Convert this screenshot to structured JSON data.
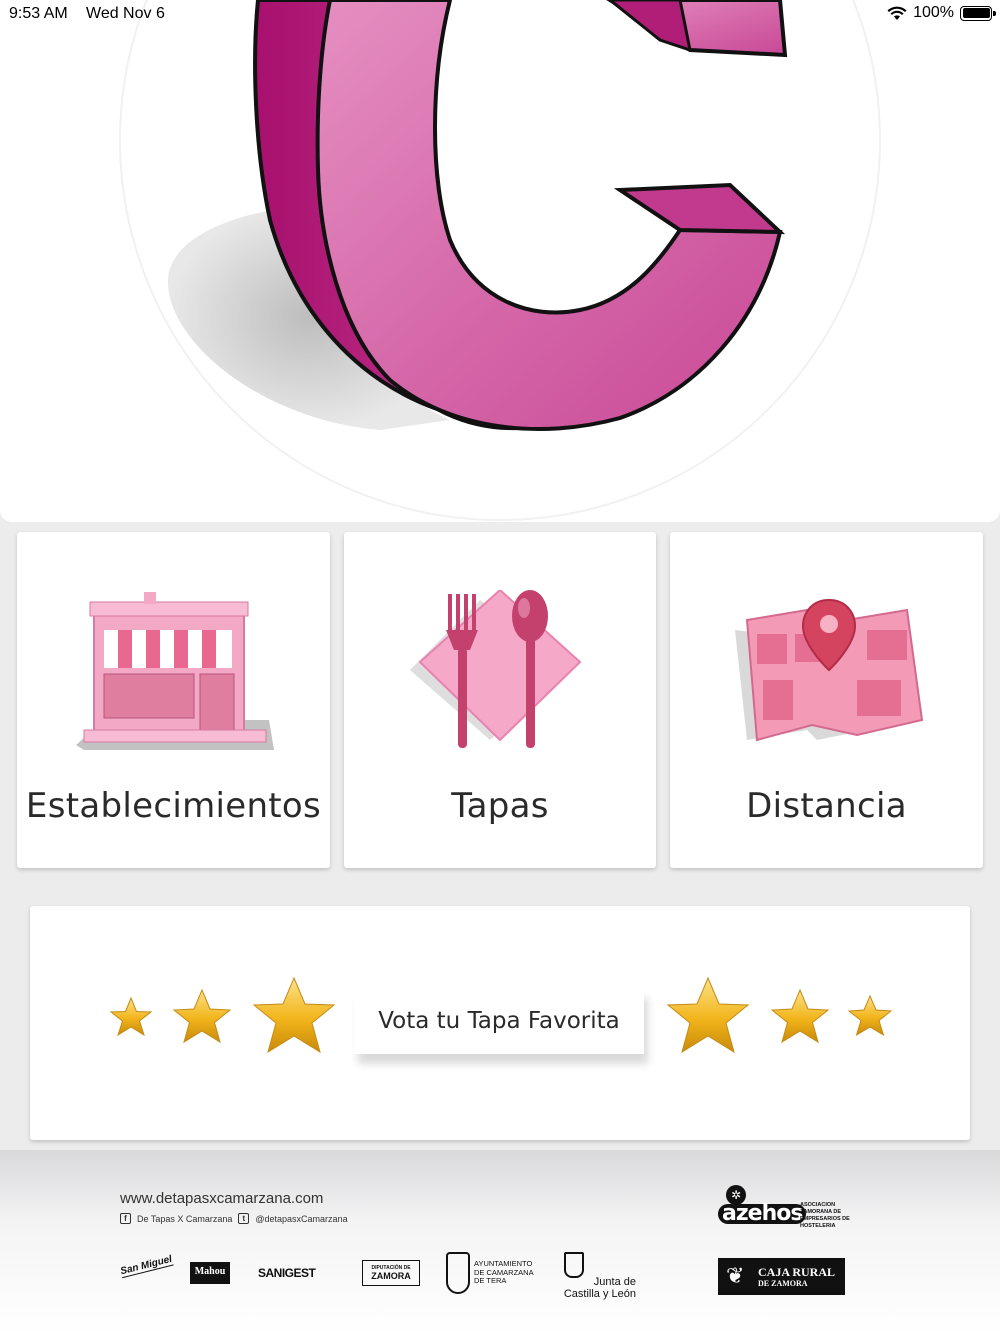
{
  "status_bar": {
    "time": "9:53 AM",
    "date": "Wed Nov 6",
    "battery_percent": "100%"
  },
  "menu": [
    {
      "label": "Establecimientos",
      "icon": "storefront-icon"
    },
    {
      "label": "Tapas",
      "icon": "fork-spoon-icon"
    },
    {
      "label": "Distancia",
      "icon": "map-pin-icon"
    }
  ],
  "vote": {
    "label": "Vota tu Tapa Favorita"
  },
  "footer": {
    "website": "www.detapasxcamarzana.com",
    "facebook": "De Tapas X Camarzana",
    "twitter": "@detapasxCamarzana",
    "azehos": {
      "name": "azehos",
      "description": "ASOCIACION ZAMORANA DE EMPRESARIOS DE HOSTELERIA"
    },
    "sponsors": {
      "sanmiguel": "San Miguel",
      "mahou": "Mahou",
      "sanigest": "SANIGEST",
      "diputacion_small": "DIPUTACIÓN DE",
      "diputacion_big": "ZAMORA",
      "camarzana": "AYUNTAMIENTO DE CAMARZANA DE TERA",
      "junta": "Junta de Castilla y León",
      "caja_rural_1": "CAJA RURAL",
      "caja_rural_2": "DE ZAMORA"
    }
  },
  "colors": {
    "brand_pink": "#c8288c",
    "brand_pink_light": "#e07fb4",
    "background": "#ececec",
    "star_gold": "#f2b51b"
  }
}
